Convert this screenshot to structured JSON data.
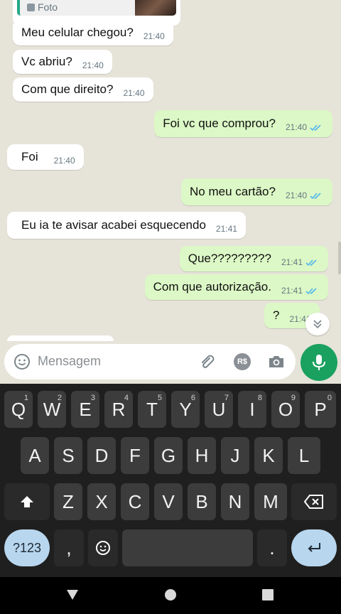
{
  "chat": {
    "quoted": {
      "label": "Foto"
    },
    "messages": [
      {
        "dir": "in",
        "text": "Meu celular chegou?",
        "time": "21:40"
      },
      {
        "dir": "in",
        "text": "Vc abriu?",
        "time": "21:40"
      },
      {
        "dir": "in",
        "text": "Com que direito?",
        "time": "21:40"
      },
      {
        "dir": "out",
        "text": "Foi vc que comprou?",
        "time": "21:40",
        "read": true
      },
      {
        "dir": "in",
        "text": "Foi",
        "time": "21:40"
      },
      {
        "dir": "out",
        "text": "No meu cartão?",
        "time": "21:40",
        "read": true
      },
      {
        "dir": "in",
        "text": "Eu ia te avisar acabei esquecendo",
        "time": "21:41"
      },
      {
        "dir": "out",
        "text": "Que?????????",
        "time": "21:41",
        "read": true
      },
      {
        "dir": "out",
        "text": "Com que autorização.",
        "time": "21:41",
        "read": true
      },
      {
        "dir": "out",
        "text": "?",
        "time": "21:41",
        "read": false
      }
    ]
  },
  "input": {
    "placeholder": "Mensagem",
    "pay_label": "R$"
  },
  "keyboard": {
    "row1": [
      {
        "k": "Q",
        "n": "1"
      },
      {
        "k": "W",
        "n": "2"
      },
      {
        "k": "E",
        "n": "3"
      },
      {
        "k": "R",
        "n": "4"
      },
      {
        "k": "T",
        "n": "5"
      },
      {
        "k": "Y",
        "n": "6"
      },
      {
        "k": "U",
        "n": "7"
      },
      {
        "k": "I",
        "n": "8"
      },
      {
        "k": "O",
        "n": "9"
      },
      {
        "k": "P",
        "n": "0"
      }
    ],
    "row2": [
      "A",
      "S",
      "D",
      "F",
      "G",
      "H",
      "J",
      "K",
      "L"
    ],
    "row3": [
      "Z",
      "X",
      "C",
      "V",
      "B",
      "N",
      "M"
    ],
    "symbols_label": "?123",
    "comma_label": ",",
    "period_label": "."
  },
  "colors": {
    "outgoing_bubble": "#dcf8c6",
    "incoming_bubble": "#ffffff",
    "accent": "#1aa15f",
    "read_ticks": "#4fb6ec"
  }
}
